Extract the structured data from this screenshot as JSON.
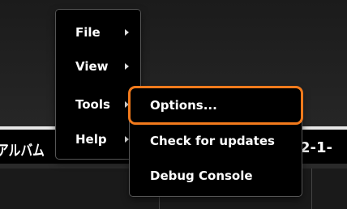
{
  "background": {
    "strip_left_text": "アルバム",
    "strip_right_text": "2-1-"
  },
  "main_menu": {
    "items": [
      {
        "label": "File"
      },
      {
        "label": "View"
      },
      {
        "label": "Tools"
      },
      {
        "label": "Help"
      }
    ]
  },
  "tools_submenu": {
    "items": [
      {
        "label": "Options..."
      },
      {
        "label": "Check for updates"
      },
      {
        "label": "Debug Console"
      }
    ]
  },
  "colors": {
    "highlight_border": "#f27a1c",
    "menu_background": "#000000",
    "menu_text": "#ffffff"
  },
  "icons": [
    "chevron-right-icon"
  ]
}
